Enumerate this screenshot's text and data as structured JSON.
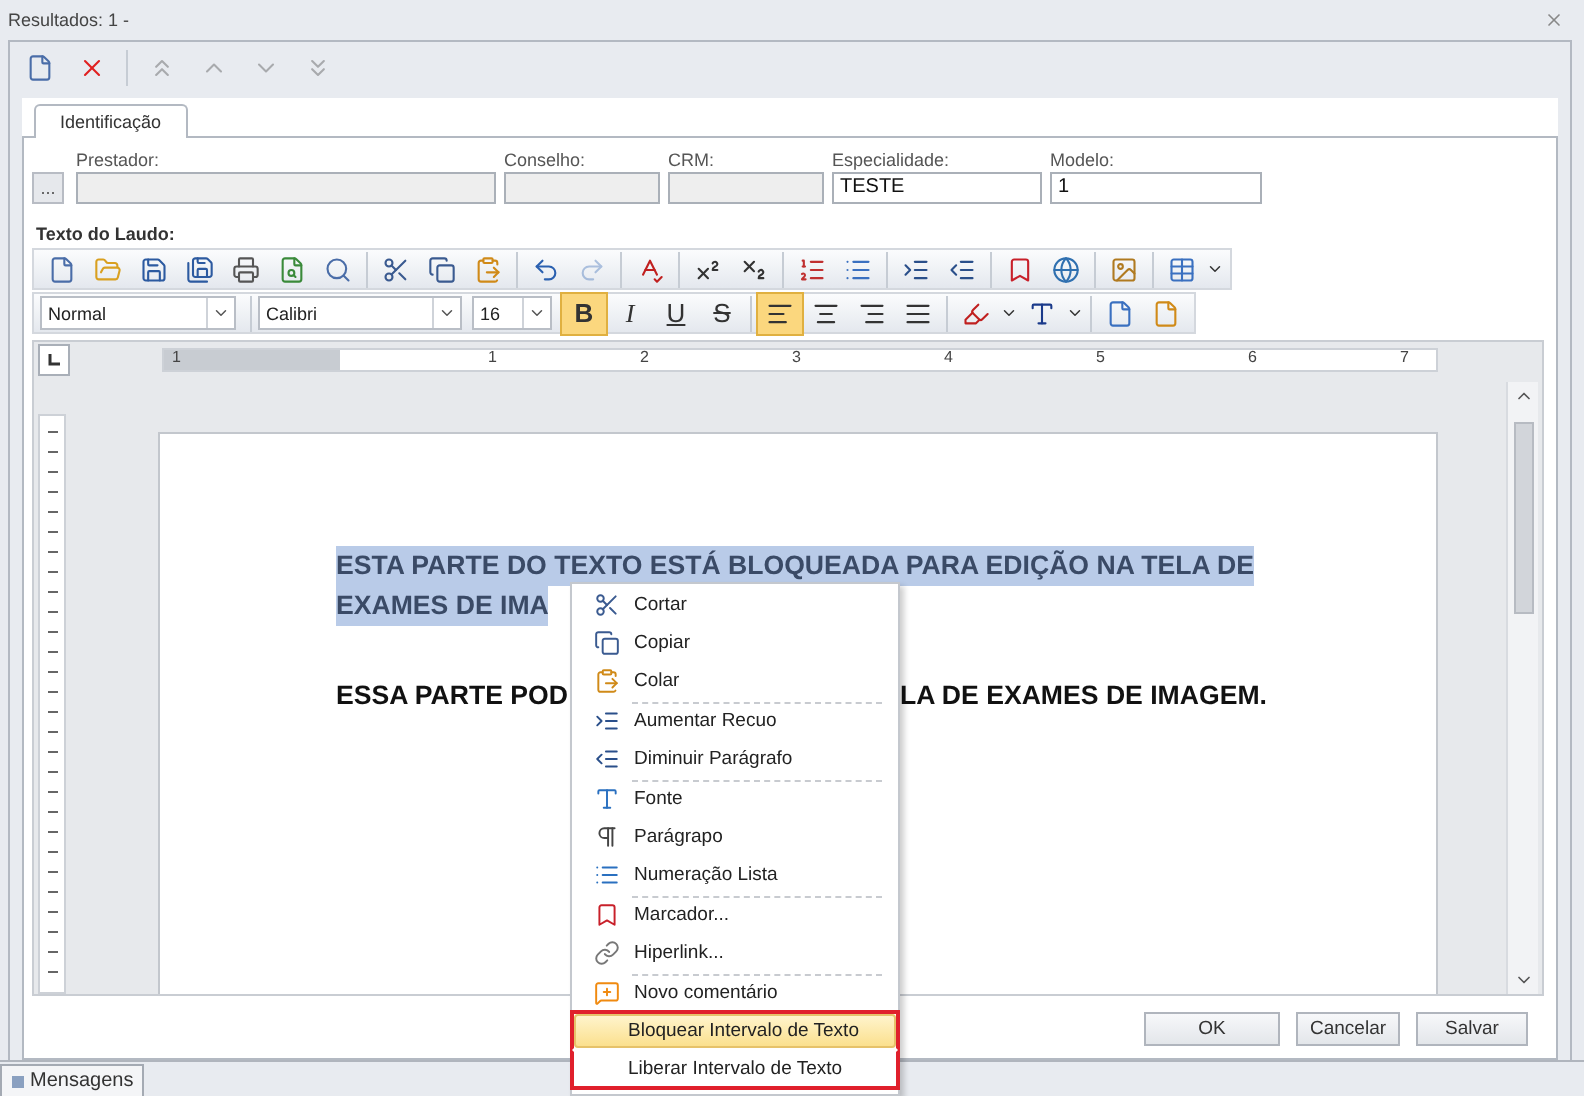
{
  "window": {
    "title": "Resultados: 1 -"
  },
  "record_toolbar": [
    {
      "kind": "new",
      "disabled": false
    },
    {
      "kind": "delete",
      "disabled": false
    },
    {
      "kind": "first",
      "disabled": true
    },
    {
      "kind": "prev",
      "disabled": true
    },
    {
      "kind": "next",
      "disabled": true
    },
    {
      "kind": "last",
      "disabled": true
    }
  ],
  "tabs": [
    {
      "label": "Identificação",
      "selected": true
    }
  ],
  "browse_button": {
    "label": "..."
  },
  "fields": [
    {
      "label": "Prestador:",
      "disabled": true
    },
    {
      "label": "Conselho:",
      "disabled": true
    },
    {
      "label": "CRM:",
      "disabled": true
    },
    {
      "label": "Especialidade:",
      "value": "TESTE",
      "disabled": false
    },
    {
      "label": "Modelo:",
      "value": "1",
      "disabled": false
    }
  ],
  "editor": {
    "label": "Texto do Laudo:",
    "toolbar": [
      {
        "kind": "new",
        "disabled": false
      },
      {
        "kind": "open",
        "disabled": false
      },
      {
        "kind": "save",
        "disabled": false
      },
      {
        "kind": "save-all",
        "disabled": false
      },
      {
        "kind": "print",
        "disabled": false
      },
      {
        "kind": "print-preview",
        "disabled": false
      },
      {
        "kind": "find",
        "disabled": false
      },
      {
        "kind": "sep"
      },
      {
        "kind": "cut",
        "disabled": false
      },
      {
        "kind": "copy",
        "disabled": false
      },
      {
        "kind": "paste",
        "disabled": false
      },
      {
        "kind": "sep"
      },
      {
        "kind": "undo",
        "disabled": false
      },
      {
        "kind": "redo",
        "disabled": true
      },
      {
        "kind": "sep"
      },
      {
        "kind": "spell",
        "disabled": false
      },
      {
        "kind": "sep"
      },
      {
        "kind": "superscript",
        "disabled": false
      },
      {
        "kind": "subscript",
        "disabled": false
      },
      {
        "kind": "sep"
      },
      {
        "kind": "numbered",
        "disabled": false
      },
      {
        "kind": "bullets",
        "disabled": false
      },
      {
        "kind": "sep"
      },
      {
        "kind": "indent",
        "disabled": false
      },
      {
        "kind": "outdent",
        "disabled": false
      },
      {
        "kind": "sep"
      },
      {
        "kind": "bookmark",
        "disabled": false
      },
      {
        "kind": "hyperlink",
        "disabled": false
      },
      {
        "kind": "sep"
      },
      {
        "kind": "image",
        "disabled": false
      },
      {
        "kind": "sep"
      },
      {
        "kind": "table",
        "disabled": false
      }
    ],
    "style": "Normal",
    "font": "Calibri",
    "size": "16",
    "format_buttons": [
      {
        "label": "B",
        "kind": "bold",
        "selected": true
      },
      {
        "label": "I",
        "kind": "italic",
        "selected": false
      },
      {
        "label": "U",
        "kind": "underline",
        "selected": false
      },
      {
        "label": "S",
        "kind": "strike",
        "selected": false
      }
    ],
    "align_buttons": [
      {
        "kind": "left",
        "selected": true
      },
      {
        "kind": "center",
        "selected": false
      },
      {
        "kind": "right",
        "selected": false
      },
      {
        "kind": "justify",
        "selected": false
      }
    ],
    "ruler": [
      "1",
      "1",
      "2",
      "3",
      "4",
      "5",
      "6",
      "7"
    ],
    "paragraphs": [
      {
        "locked": true,
        "lines": [
          [
            "ESTA PARTE DO TEXTO ESTÁ BLOQUEADA PARA EDIÇÃO NA TELA DE"
          ],
          [
            "EXAMES DE IMA"
          ]
        ]
      },
      {
        "locked": false,
        "lines": [
          [
            "ESSA PARTE POD",
            "LA DE EXAMES DE IMAGEM."
          ]
        ]
      }
    ]
  },
  "context_menu": [
    {
      "kind": "cut",
      "label": "Cortar",
      "selected": false,
      "separator_before": false,
      "outlined": false
    },
    {
      "kind": "copy",
      "label": "Copiar",
      "selected": false,
      "separator_before": false,
      "outlined": false
    },
    {
      "kind": "paste",
      "label": "Colar",
      "selected": false,
      "separator_before": false,
      "outlined": false
    },
    {
      "kind": "indent",
      "label": "Aumentar Recuo",
      "selected": false,
      "separator_before": true,
      "outlined": false
    },
    {
      "kind": "outdent",
      "label": "Diminuir Parágrafo",
      "selected": false,
      "separator_before": false,
      "outlined": false
    },
    {
      "kind": "font",
      "label": "Fonte",
      "selected": false,
      "separator_before": true,
      "outlined": false
    },
    {
      "kind": "paragraph",
      "label": "Parágrapo",
      "selected": false,
      "separator_before": false,
      "outlined": false
    },
    {
      "kind": "list",
      "label": "Numeração Lista",
      "selected": false,
      "separator_before": false,
      "outlined": false
    },
    {
      "kind": "bookmark",
      "label": "Marcador...",
      "selected": false,
      "separator_before": true,
      "outlined": false
    },
    {
      "kind": "hyperlink",
      "label": "Hiperlink...",
      "selected": false,
      "separator_before": false,
      "outlined": false
    },
    {
      "kind": "comment",
      "label": "Novo comentário",
      "selected": false,
      "separator_before": true,
      "outlined": false
    },
    {
      "kind": "none",
      "label": "Bloquear Intervalo de Texto",
      "selected": true,
      "separator_before": false,
      "outlined": true
    },
    {
      "kind": "none",
      "label": "Liberar Intervalo de Texto",
      "selected": false,
      "separator_before": false,
      "outlined": true
    }
  ],
  "buttons": [
    "OK",
    "Cancelar",
    "Salvar"
  ],
  "taskbar": [
    {
      "label": "Mensagens"
    }
  ]
}
